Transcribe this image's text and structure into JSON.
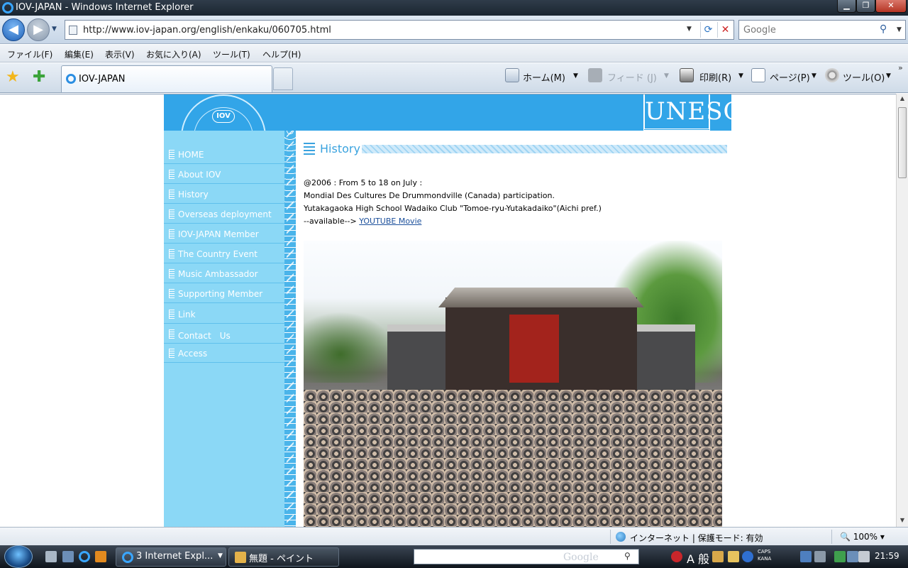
{
  "window": {
    "title": "IOV-JAPAN - Windows Internet Explorer",
    "address_url": "http://www.iov-japan.org/english/enkaku/060705.html",
    "search_placeholder": "Google"
  },
  "menu": [
    "ファイル(F)",
    "編集(E)",
    "表示(V)",
    "お気に入り(A)",
    "ツール(T)",
    "ヘルプ(H)"
  ],
  "tab": {
    "label": "IOV-JAPAN"
  },
  "command_bar": {
    "home": "ホーム(M)",
    "feeds": "フィード (J)",
    "print": "印刷(R)",
    "page": "ページ(P)",
    "tools": "ツール(O)"
  },
  "site": {
    "logo_text": "IOV",
    "unesco_text": "UNESCO",
    "nav": [
      "HOME",
      "About IOV",
      "History",
      "Overseas deployment",
      "IOV-JAPAN Member",
      "The Country Event",
      "Music Ambassador",
      "Supporting Member",
      "Link",
      "Contact　Us",
      "Access"
    ],
    "section_title": "History",
    "lines": [
      "@2006 : From 5 to 18 on July :",
      "Mondial Des Cultures De Drummondville (Canada) participation.",
      "Yutakagaoka High School Wadaiko Club \"Tomoe-ryu-Yutakadaiko\"(Aichi pref.)"
    ],
    "available_prefix": "--available-->",
    "youtube_link": "YOUTUBE Movie"
  },
  "status": {
    "zone": "インターネット | 保護モード: 有効",
    "zoom": "100%"
  },
  "taskbar": {
    "ie_button": "3 Internet Expl...",
    "paint_button": "無題 - ペイント",
    "search_watermark": "Google",
    "ime_label": "A 般",
    "caps_label": "CAPS",
    "kana_label": "KANA",
    "clock": "21:59"
  }
}
